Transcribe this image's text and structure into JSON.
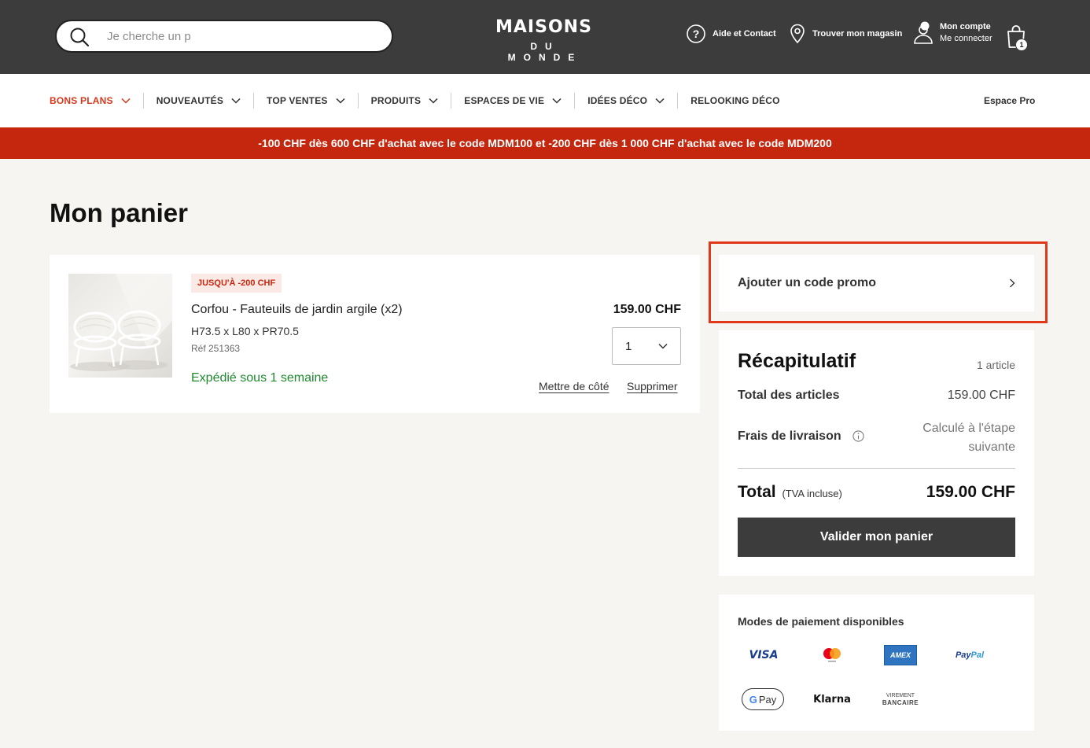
{
  "header": {
    "search_placeholder": "Je cherche un p",
    "logo_line1": "MAISONS",
    "logo_line2": "DU MONDE",
    "help_label": "Aide et Contact",
    "store_label": "Trouver mon magasin",
    "account_label": "Mon compte",
    "account_sub": "Me connecter",
    "cart_count": "1"
  },
  "nav": {
    "items": [
      {
        "label": "BONS PLANS"
      },
      {
        "label": "NOUVEAUTÉS"
      },
      {
        "label": "TOP VENTES"
      },
      {
        "label": "PRODUITS"
      },
      {
        "label": "ESPACES DE VIE"
      },
      {
        "label": "IDÉES DÉCO"
      },
      {
        "label": "RELOOKING DÉCO"
      }
    ],
    "espace_pro": "Espace Pro"
  },
  "banner": {
    "text": "-100 CHF dès 600 CHF d'achat avec le code MDM100 et -200 CHF dès 1 000 CHF d'achat avec le code MDM200"
  },
  "page": {
    "title": "Mon panier"
  },
  "product": {
    "badge": "JUSQU'À -200 CHF",
    "name": "Corfou - Fauteuils de jardin argile (x2)",
    "dimensions": "H73.5 x L80 x PR70.5",
    "reference": "Réf 251363",
    "shipping": "Expédié sous 1 semaine",
    "price": "159.00 CHF",
    "quantity": "1",
    "save_later": "Mettre de côté",
    "delete": "Supprimer"
  },
  "promo": {
    "label": "Ajouter un code promo"
  },
  "recap": {
    "title": "Récapitulatif",
    "count": "1 article",
    "items_total_label": "Total des articles",
    "items_total_value": "159.00 CHF",
    "shipping_label": "Frais de livraison",
    "shipping_value_line1": "Calculé à l'étape",
    "shipping_value_line2": "suivante",
    "total_label": "Total",
    "total_tax": "(TVA incluse)",
    "total_value": "159.00 CHF",
    "validate_button": "Valider mon panier"
  },
  "payment": {
    "title": "Modes de paiement disponibles",
    "visa": "VISA",
    "amex": "AMEX",
    "paypal_1": "Pay",
    "paypal_2": "Pal",
    "gpay_g": "G",
    "gpay_text": "Pay",
    "klarna": "Klarna",
    "virement_1": "VIREMENT",
    "virement_2": "BANCAIRE"
  },
  "colors": {
    "header_bg": "#3c3c3c",
    "banner_bg": "#c4270e",
    "accent": "#d8371b",
    "shipping_green": "#1e8a2e",
    "highlight_frame": "#e0391a"
  }
}
